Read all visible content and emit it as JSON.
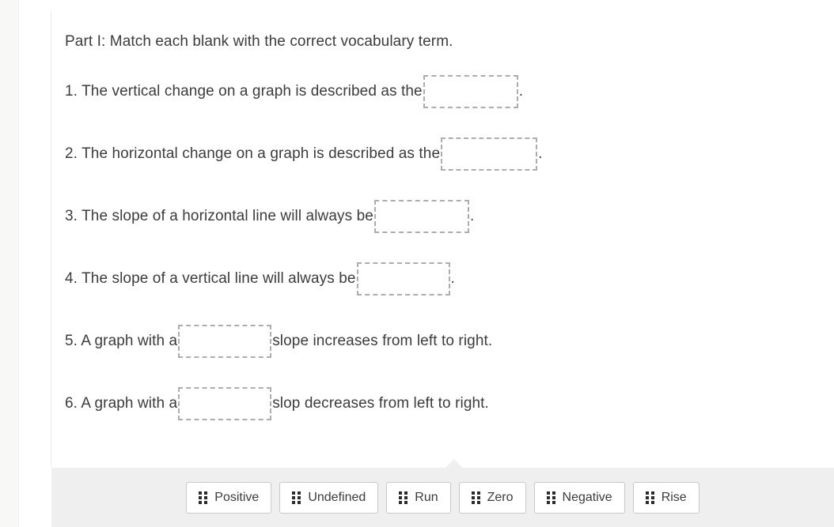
{
  "worksheet": {
    "part_heading": "Part I: Match each blank with the correct vocabulary term.",
    "questions": [
      {
        "number": "1.",
        "lead": "1. The vertical change on a graph is described as the",
        "blank_name": "blank-1",
        "blank_value": "",
        "tail": "."
      },
      {
        "number": "2.",
        "lead": "2. The horizontal change on a graph is described as the",
        "blank_name": "blank-2",
        "blank_value": "",
        "tail": "."
      },
      {
        "number": "3.",
        "lead": "3. The slope of a horizontal line will always be",
        "blank_name": "blank-3",
        "blank_value": "",
        "tail": "."
      },
      {
        "number": "4.",
        "lead": "4. The slope of a vertical line will always be",
        "blank_name": "blank-4",
        "blank_value": "",
        "tail": "."
      },
      {
        "number": "5.",
        "lead": "5. A graph with a",
        "blank_name": "blank-5",
        "blank_value": "",
        "tail": "slope increases from left to right."
      },
      {
        "number": "6.",
        "lead": "6. A graph with a",
        "blank_name": "blank-6",
        "blank_value": "",
        "tail": "slop decreases from left to right."
      }
    ]
  },
  "tray": {
    "drag_handle_icon": "grip-dots-icon",
    "chips": [
      {
        "label": "Positive"
      },
      {
        "label": "Undefined"
      },
      {
        "label": "Run"
      },
      {
        "label": "Zero"
      },
      {
        "label": "Negative"
      },
      {
        "label": "Rise"
      }
    ]
  },
  "colors": {
    "text": "#3c3c3c",
    "tray_background": "#efefef",
    "drop_zone_border": "#adadad",
    "chip_border": "#c9c9c9",
    "rail_background": "#f8f8f7"
  }
}
